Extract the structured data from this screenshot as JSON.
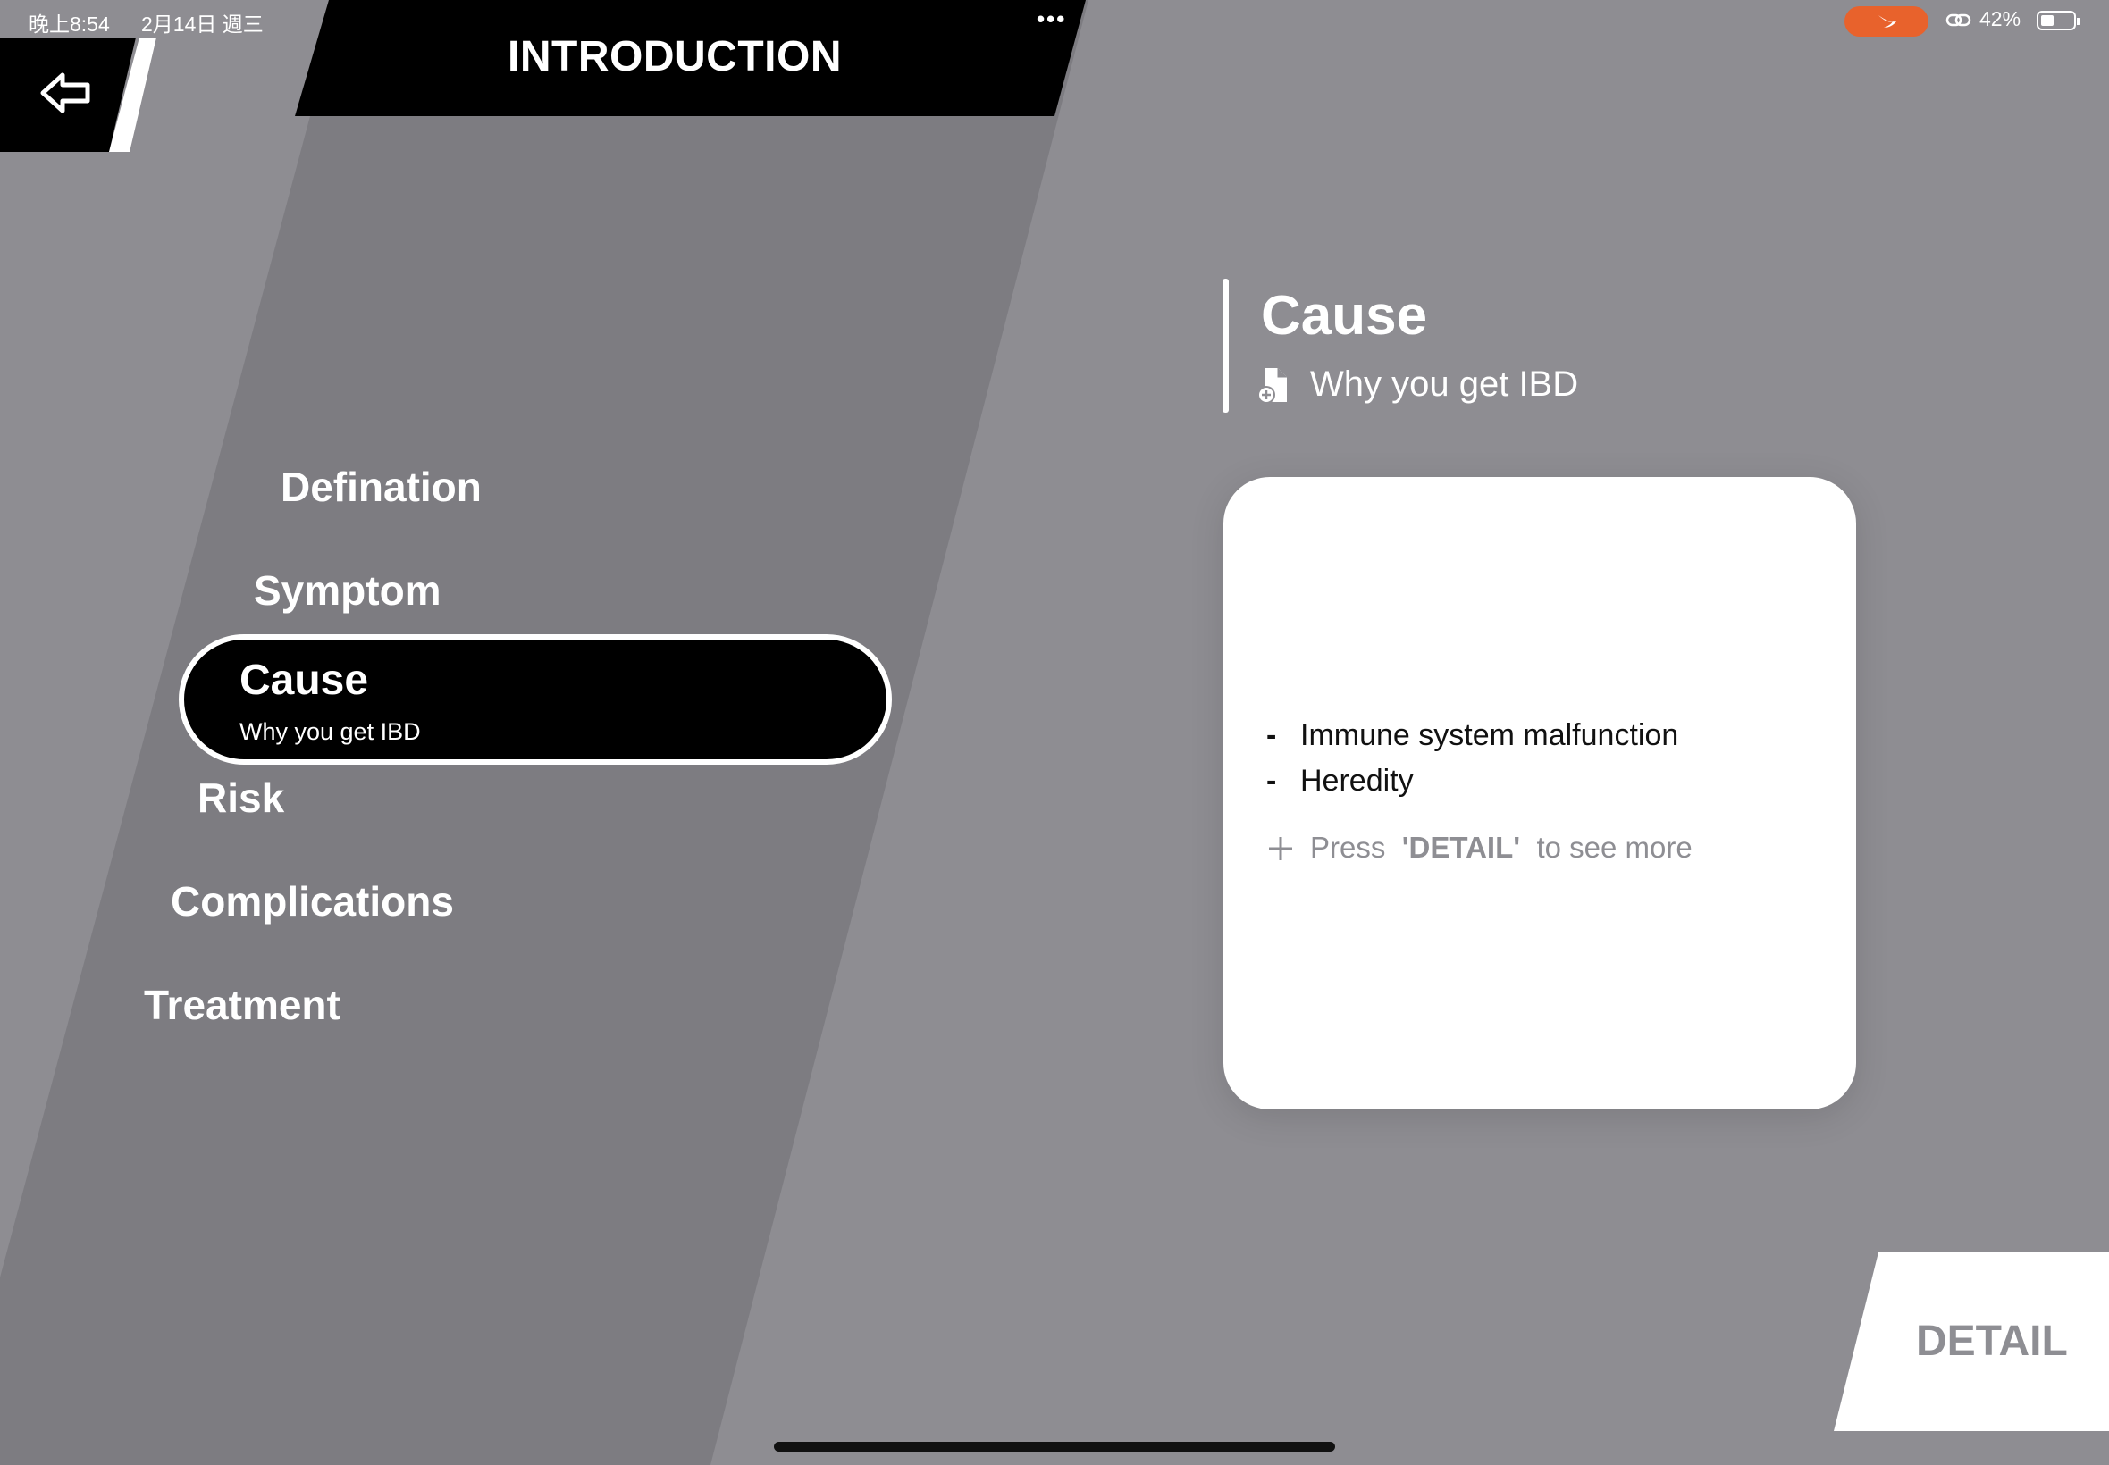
{
  "status_bar": {
    "time": "晚上8:54",
    "date": "2月14日 週三",
    "more": "•••",
    "battery_label": "42%",
    "battery_level": 0.42,
    "accent_color": "#e8622c"
  },
  "header": {
    "title": "INTRODUCTION",
    "back_icon": "back-arrow-icon"
  },
  "menu": {
    "items": [
      {
        "label": "Defination"
      },
      {
        "label": "Symptom"
      },
      {
        "label": "Risk"
      },
      {
        "label": "Complications"
      },
      {
        "label": "Treatment"
      }
    ],
    "active": {
      "label": "Cause",
      "subtitle": "Why you get IBD"
    }
  },
  "content": {
    "title": "Cause",
    "subtitle": "Why you get IBD",
    "subtitle_icon": "document-add-icon",
    "card": {
      "bullets": [
        {
          "dash": "-",
          "text": "Immune system malfunction"
        },
        {
          "dash": "-",
          "text": "Heredity"
        }
      ],
      "hint": {
        "icon": "plus-icon",
        "pre": "Press",
        "keyword": "'DETAIL'",
        "post": "to see more"
      }
    }
  },
  "detail_button": {
    "label": "DETAIL"
  },
  "colors": {
    "background": "#8e8d92",
    "panel": "#7d7c81",
    "active_fill": "#000000",
    "text": "#ffffff"
  }
}
